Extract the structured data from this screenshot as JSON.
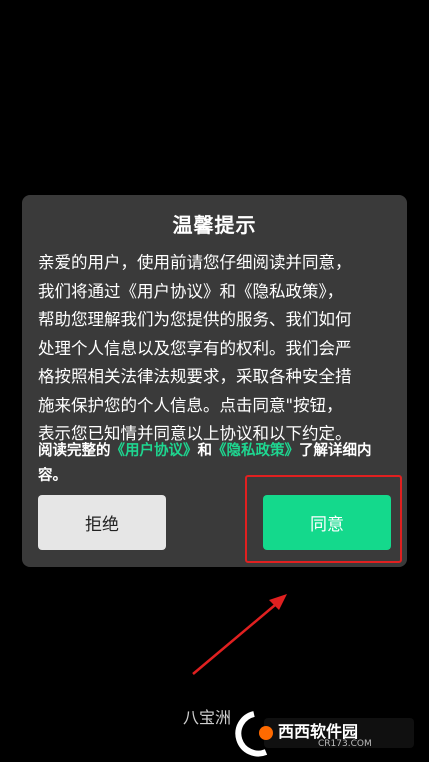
{
  "dialog": {
    "title": "温馨提示",
    "body_lines": [
      "亲爱的用户，使用前请您仔细阅读并同意，",
      "我们将通过《用户协议》和《隐私政策》，",
      "帮助您理解我们为您提供的服务、我们如何",
      "处理个人信息以及您享有的权利。我们会严",
      "格按照相关法律法规要求，采取各种安全措",
      "施来保护您的个人信息。点击同意\"按钮，",
      "表示您已知情并同意以上协议和以下约定。"
    ],
    "links_line": {
      "prefix": "阅读完整的",
      "user_agreement": "《用户协议》",
      "and": "和",
      "privacy_policy": "《隐私政策》",
      "suffix": "了解详细内容。"
    },
    "decline_label": "拒绝",
    "agree_label": "同意"
  },
  "watermark": {
    "text": "八宝洲",
    "logo_text": "西西软件园",
    "logo_sub": "CR173.COM"
  },
  "colors": {
    "link": "#1ed690",
    "agree_button": "#14d98c",
    "annotation": "#e02020"
  }
}
